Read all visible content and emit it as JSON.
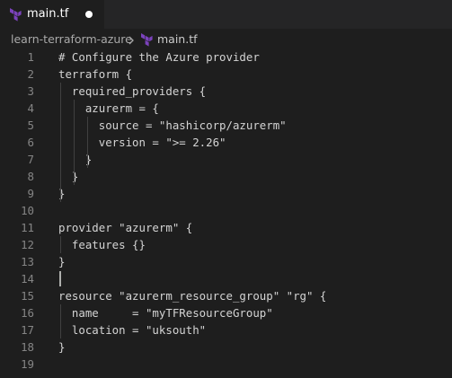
{
  "tab": {
    "label": "main.tf",
    "dirty": true
  },
  "breadcrumb": {
    "folder": "learn-terraform-azure",
    "file": "main.tf"
  },
  "editor": {
    "language": "terraform",
    "cursor_line": 14,
    "lines": [
      {
        "num": "1",
        "text": "# Configure the Azure provider"
      },
      {
        "num": "2",
        "text": "terraform {"
      },
      {
        "num": "3",
        "text": "  required_providers {"
      },
      {
        "num": "4",
        "text": "    azurerm = {"
      },
      {
        "num": "5",
        "text": "      source = \"hashicorp/azurerm\""
      },
      {
        "num": "6",
        "text": "      version = \">= 2.26\""
      },
      {
        "num": "7",
        "text": "    }"
      },
      {
        "num": "8",
        "text": "  }"
      },
      {
        "num": "9",
        "text": "}"
      },
      {
        "num": "10",
        "text": ""
      },
      {
        "num": "11",
        "text": "provider \"azurerm\" {"
      },
      {
        "num": "12",
        "text": "  features {}"
      },
      {
        "num": "13",
        "text": "}"
      },
      {
        "num": "14",
        "text": ""
      },
      {
        "num": "15",
        "text": "resource \"azurerm_resource_group\" \"rg\" {"
      },
      {
        "num": "16",
        "text": "  name     = \"myTFResourceGroup\""
      },
      {
        "num": "17",
        "text": "  location = \"uksouth\""
      },
      {
        "num": "18",
        "text": "}"
      },
      {
        "num": "19",
        "text": ""
      }
    ]
  },
  "colors": {
    "editor_bg": "#1e1e1e",
    "tabbar_bg": "#252526",
    "text": "#d4d4d4",
    "line_number": "#858585",
    "terraform_icon": "#7b42bc"
  },
  "icons": {
    "file": "terraform-icon",
    "separator": "chevron-right-icon"
  }
}
